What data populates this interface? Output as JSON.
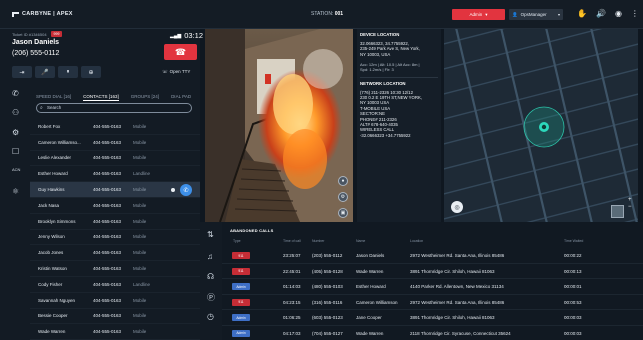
{
  "app": {
    "brand": "CARBYNE | APEX",
    "station_label": "STATION:",
    "station_value": "001"
  },
  "topbar": {
    "status_label": "Admin",
    "user_label": "OpsManager",
    "icons": [
      "hand-icon",
      "volume-icon",
      "account-icon",
      "more-icon"
    ]
  },
  "call": {
    "ticket_label": "Ticket ID #1346504",
    "ticket_tag": "999",
    "caller_name": "Jason Daniels",
    "caller_phone": "(206) 555-0112",
    "timer": "03:12",
    "open_tty_label": "Open TTY"
  },
  "contacts_panel": {
    "tabs": [
      "SPEED DIAL [16]",
      "CONTACTS [163]",
      "GROUPS [24]",
      "DIAL PAD"
    ],
    "active_tab": 1,
    "search_placeholder": "Search",
    "rows": [
      {
        "name": "Robert Fox",
        "phone": "404-555-0163",
        "type": "Mobile"
      },
      {
        "name": "Cameron Williamso...",
        "phone": "404-555-0163",
        "type": "Mobile"
      },
      {
        "name": "Leslie Alexander",
        "phone": "404-555-0163",
        "type": "Mobile"
      },
      {
        "name": "Esther Howard",
        "phone": "404-555-0163",
        "type": "Landline"
      },
      {
        "name": "Guy Hawkins",
        "phone": "404-555-0163",
        "type": "Mobile",
        "selected": true
      },
      {
        "name": "Jack Nasa",
        "phone": "404-555-0163",
        "type": "Mobile"
      },
      {
        "name": "Brooklyn Simmons",
        "phone": "404-555-0163",
        "type": "Mobile"
      },
      {
        "name": "Jenny Wilson",
        "phone": "404-555-0163",
        "type": "Mobile"
      },
      {
        "name": "Jacob Jones",
        "phone": "404-555-0163",
        "type": "Mobile"
      },
      {
        "name": "Kristin Watson",
        "phone": "404-555-0163",
        "type": "Mobile"
      },
      {
        "name": "Cody Fisher",
        "phone": "404-555-0163",
        "type": "Landline"
      },
      {
        "name": "Savannah Nguyen",
        "phone": "404-555-0163",
        "type": "Mobile"
      },
      {
        "name": "Bessie Cooper",
        "phone": "404-555-0163",
        "type": "Mobile"
      },
      {
        "name": "Wade Warren",
        "phone": "404-555-0163",
        "type": "Mobile"
      }
    ]
  },
  "device": {
    "location_title": "DEVICE LOCATION",
    "location_lines": [
      "32.0666323, 34.7755922,",
      "235-249 Park Ave S, New York,",
      "NY 10003, USA"
    ],
    "accuracy_lines": [
      "Acc: 12m | Alt: 10.5 | Alt Acc: 8m |",
      "Spd: 1.2m/s | Flr: 3"
    ],
    "network_title": "NETWORK LOCATION",
    "network_lines": [
      "(776) 211-2326 10:30 12/12",
      "230 0.2 E 19TH ST,NEW YORK,",
      "NY 10003 USA",
      "T-MOBILE USA",
      "SECTOR:NE",
      "PHONE# 211-2326",
      "ALT# 678-640-4035",
      "WIRELESS CALL",
      "-32.0666323 +34.7755922"
    ]
  },
  "abandoned": {
    "title": "ABANDONED CALLS",
    "columns": [
      "Type",
      "Time of call",
      "Number",
      "Name",
      "Location",
      "Time Waited"
    ],
    "rows": [
      {
        "type": "911",
        "color": "red",
        "time": "23:25:07",
        "number": "(203) 555-0112",
        "name": "Jason Daniels",
        "location": "2972 Westheimer Rd. Santa Ana, Illinois 85486",
        "waited": "00:00:22"
      },
      {
        "type": "911",
        "color": "red",
        "time": "22:45:01",
        "number": "(405) 555-0128",
        "name": "Wade Warren",
        "location": "3891 Thornridge Cir. Shiloh, Hawaii 81063",
        "waited": "00:00:13"
      },
      {
        "type": "Admin",
        "color": "blue",
        "time": "01:14:03",
        "number": "(480) 555-0103",
        "name": "Esther Howard",
        "location": "4140 Parker Rd. Allentown, New Mexico 31134",
        "waited": "00:00:01"
      },
      {
        "type": "911",
        "color": "red",
        "time": "04:23:15",
        "number": "(316) 555-0116",
        "name": "Cameron Williamson",
        "location": "2972 Westheimer Rd. Santa Ana, Illinois 85486",
        "waited": "00:00:53"
      },
      {
        "type": "Admin",
        "color": "blue",
        "time": "01:06:25",
        "number": "(603) 555-0123",
        "name": "Jane Cooper",
        "location": "3891 Thornridge Cir. Shiloh, Hawaii 81063",
        "waited": "00:00:03"
      },
      {
        "type": "Admin",
        "color": "blue",
        "time": "04:17:03",
        "number": "(704) 555-0127",
        "name": "Wade Warren",
        "location": "2118 Thornridge Cir. Syracuse, Connecticut 35624",
        "waited": "00:00:03"
      }
    ]
  },
  "map": {
    "street_labels": [
      "E 37th St",
      "E 36th St",
      "E 35th St",
      "E 34th St",
      "E 33rd St",
      "E 32nd St",
      "E 31st St",
      "E 30th St",
      "E 29th St",
      "E 28th St",
      "E 27th St",
      "E 26th St",
      "E 25th St",
      "E 24th St",
      "E 23rd St",
      "E 22nd St",
      "E 21st St",
      "E 20th St",
      "Park Ave S",
      "Lexington Ave"
    ]
  }
}
